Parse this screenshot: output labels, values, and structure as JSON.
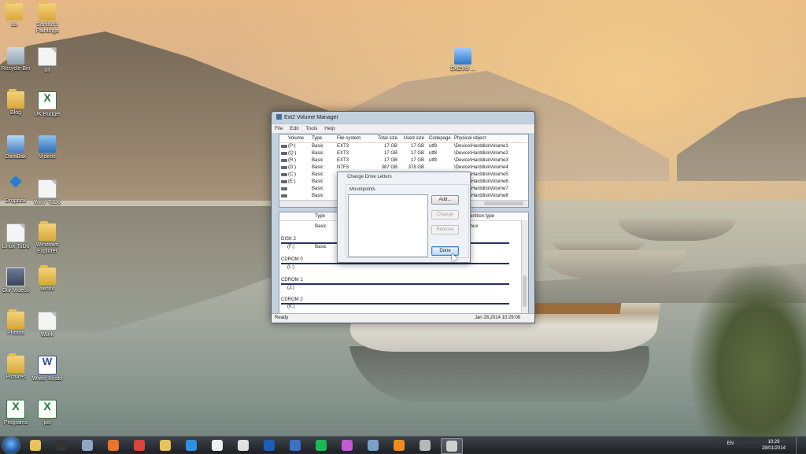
{
  "desktop": {
    "icons": [
      {
        "label": "aa",
        "icon": "folder-icon"
      },
      {
        "label": "Sandra's Paintings",
        "icon": "folder-icon"
      },
      {
        "label": "Recycle Bin",
        "icon": "recycle-bin-icon"
      },
      {
        "label": "bit",
        "icon": "document-icon"
      },
      {
        "label": "Blog",
        "icon": "folder-icon"
      },
      {
        "label": "UK Budget",
        "icon": "excel-icon"
      },
      {
        "label": "DataBak",
        "icon": "network-icon"
      },
      {
        "label": "Videos",
        "icon": "media-icon"
      },
      {
        "label": "Dropbox",
        "icon": "dropbox-icon"
      },
      {
        "label": "Win7 ToDo",
        "icon": "document-icon"
      },
      {
        "label": "Linux ToDo",
        "icon": "document-icon"
      },
      {
        "label": "Windows Explorer",
        "icon": "folder-icon"
      },
      {
        "label": "Our Videos",
        "icon": "photo-icon"
      },
      {
        "label": "winfix",
        "icon": "folder-icon"
      },
      {
        "label": "Photos",
        "icon": "folder-icon"
      },
      {
        "label": "Work",
        "icon": "document-icon"
      },
      {
        "label": "Pictures",
        "icon": "folder-icon"
      },
      {
        "label": "Writer Kristo",
        "icon": "word-icon"
      },
      {
        "label": "Programs",
        "icon": "excel-icon"
      },
      {
        "label": "pis",
        "icon": "excel-icon"
      },
      {
        "label": "Ext2Vol ...",
        "icon": "setup-icon"
      }
    ]
  },
  "window": {
    "title": "Ext2 Volume Manager",
    "menu": [
      "File",
      "Edit",
      "Tools",
      "Help"
    ],
    "volume_table": {
      "columns": [
        "Volume",
        "Type",
        "File system",
        "Total size",
        "Used size",
        "Codepage",
        "Physical object"
      ],
      "rows": [
        [
          "(P:)",
          "Basic",
          "EXT3",
          "17 GB",
          "17 GB",
          "utf8",
          "\\Device\\HarddiskVolume1"
        ],
        [
          "(Q:)",
          "Basic",
          "EXT3",
          "17 GB",
          "17 GB",
          "utf8",
          "\\Device\\HarddiskVolume2"
        ],
        [
          "(R:)",
          "Basic",
          "EXT3",
          "17 GB",
          "17 GB",
          "utf8",
          "\\Device\\HarddiskVolume3"
        ],
        [
          "(D:)",
          "Basic",
          "NTFS",
          "387 GB",
          "378 GB",
          "",
          "\\Device\\HarddiskVolume4"
        ],
        [
          "(C:)",
          "Basic",
          "",
          "",
          "",
          "",
          "\\Device\\HarddiskVolume5"
        ],
        [
          "(E:)",
          "Basic",
          "",
          "",
          "",
          "",
          "\\Device\\HarddiskVolume6"
        ],
        [
          "",
          "Basic",
          "",
          "",
          "",
          "",
          "\\Device\\HarddiskVolume7"
        ],
        [
          "",
          "Basic",
          "",
          "",
          "",
          "",
          "\\Device\\HarddiskVolume8"
        ]
      ]
    },
    "disk_pane": {
      "header_type": "Type",
      "header_partition": "Partition type",
      "basic_label": "Basic",
      "linux_label": "Linux",
      "disk2": "DISK 2",
      "disk2_vol": "(F:)",
      "disk2_type": "Basic",
      "cdrom0": "CDROM 0",
      "cdrom0_vol": "(L:)",
      "cdrom1": "CDROM 1",
      "cdrom1_vol": "(J:)",
      "cdrom2": "CDROM 2",
      "cdrom2_vol": "(K:)"
    },
    "status_left": "Ready",
    "status_right": "Jan 28,2014 10:29:08"
  },
  "dialog": {
    "title": "Change Drive Letters",
    "group_label": "Mountpoints",
    "add_label": "Add...",
    "change_label": "Change",
    "remove_label": "Remove",
    "done_label": "Done"
  },
  "taskbar": {
    "language": "EN",
    "time": "10:29",
    "date": "28/01/2014",
    "items": [
      "explorer-icon",
      "terminal-icon",
      "monitor-icon",
      "firefox-icon",
      "chrome-icon",
      "folder-icon",
      "ie-icon",
      "media-player-icon",
      "sumatra-icon",
      "teamviewer-icon",
      "thunderbird-icon",
      "spotify-icon",
      "picasa-icon",
      "skype-icon",
      "vlc-icon",
      "disk-icon",
      "ext2-icon"
    ]
  }
}
